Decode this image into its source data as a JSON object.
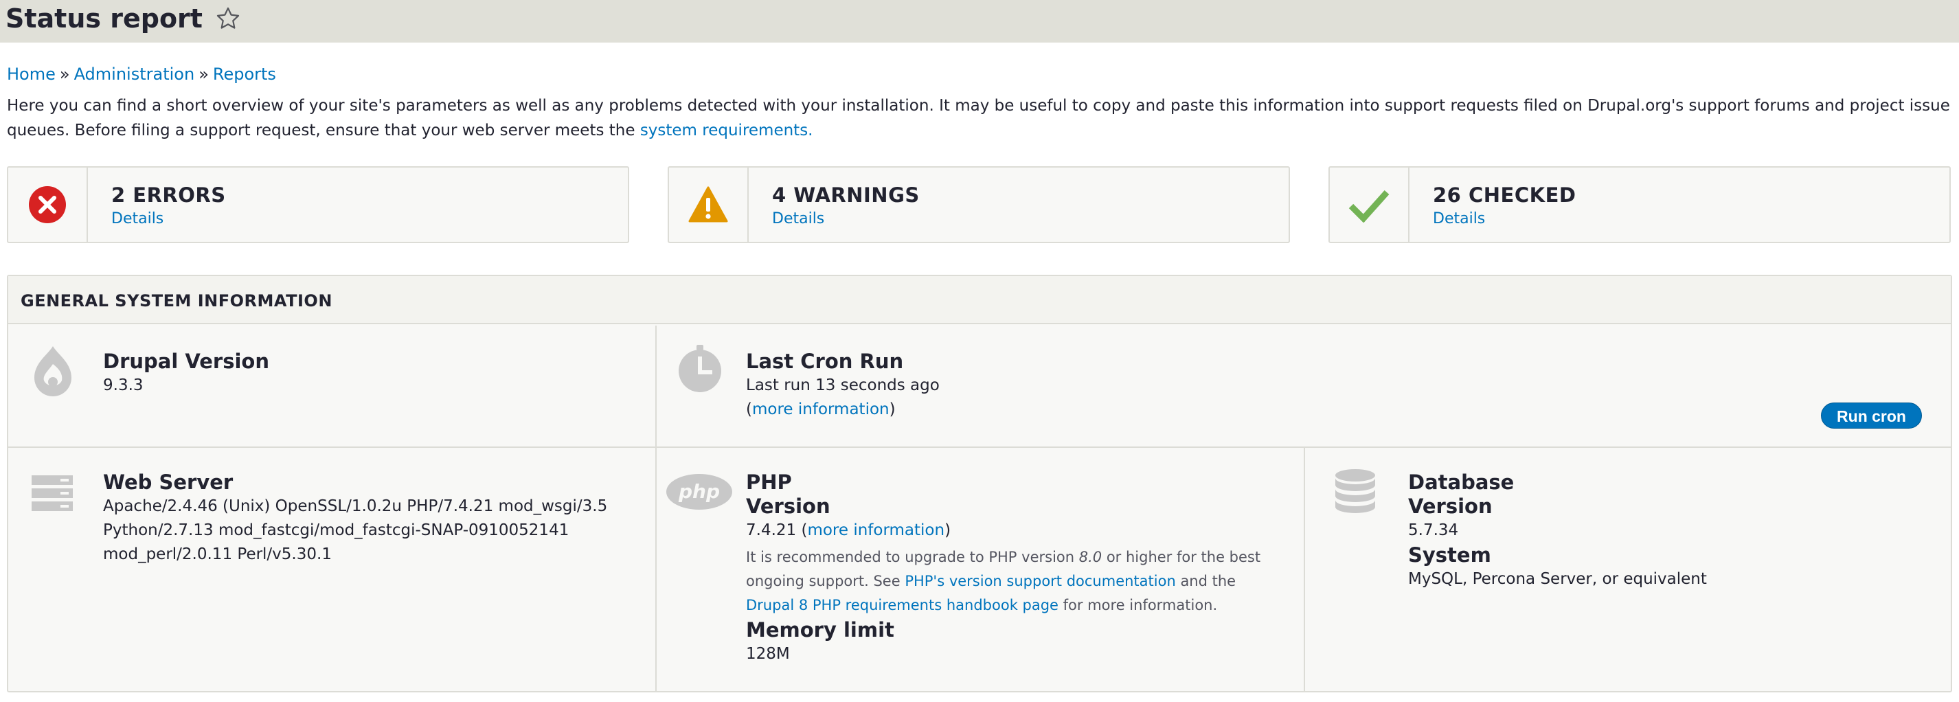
{
  "header": {
    "title": "Status report"
  },
  "breadcrumb": {
    "items": [
      "Home",
      "Administration",
      "Reports"
    ],
    "separator": "»"
  },
  "intro": {
    "text": "Here you can find a short overview of your site's parameters as well as any problems detected with your installation. It may be useful to copy and paste this information into support requests filed on Drupal.org's support forums and project issue queues. Before filing a support request, ensure that your web server meets the ",
    "link": "system requirements."
  },
  "summary": {
    "errors": {
      "count": "2 ERRORS",
      "details": "Details",
      "color": "#d72222"
    },
    "warnings": {
      "count": "4 WARNINGS",
      "details": "Details",
      "color": "#e29700"
    },
    "checked": {
      "count": "26 CHECKED",
      "details": "Details",
      "color": "#42a877"
    }
  },
  "general": {
    "title": "GENERAL SYSTEM INFORMATION",
    "drupal": {
      "title": "Drupal Version",
      "value": "9.3.3",
      "icon": "drupal-drop-icon"
    },
    "cron": {
      "title": "Last Cron Run",
      "value": "Last run 13 seconds ago",
      "more_open": "(",
      "more_link": "more information",
      "more_close": ")",
      "button": "Run cron",
      "icon": "clock-icon"
    },
    "webserver": {
      "title": "Web Server",
      "lines": [
        "Apache/2.4.46 (Unix) OpenSSL/1.0.2u PHP/7.4.21 mod_wsgi/3.5",
        "Python/2.7.13 mod_fastcgi/mod_fastcgi-SNAP-0910052141",
        "mod_perl/2.0.11 Perl/v5.30.1"
      ],
      "icon": "server-icon"
    },
    "php": {
      "title": "PHP",
      "version_label": "Version",
      "version_value": "7.4.21 (",
      "version_link": "more information",
      "version_close": ")",
      "note_1": "It is recommended to upgrade to PHP version ",
      "note_version": "8.0",
      "note_2": " or higher for the best",
      "note_3": "ongoing support. See ",
      "note_link_1": "PHP's version support documentation",
      "note_4": " and the",
      "note_link_2": "Drupal 8 PHP requirements handbook page",
      "note_5": " for more information.",
      "memory_label": "Memory limit",
      "memory_value": "128M",
      "logo_text": "php",
      "icon": "php-logo-icon"
    },
    "database": {
      "title": "Database",
      "version_label": "Version",
      "version_value": "5.7.34",
      "system_label": "System",
      "system_value": "MySQL, Percona Server, or equivalent",
      "icon": "database-icon"
    }
  }
}
